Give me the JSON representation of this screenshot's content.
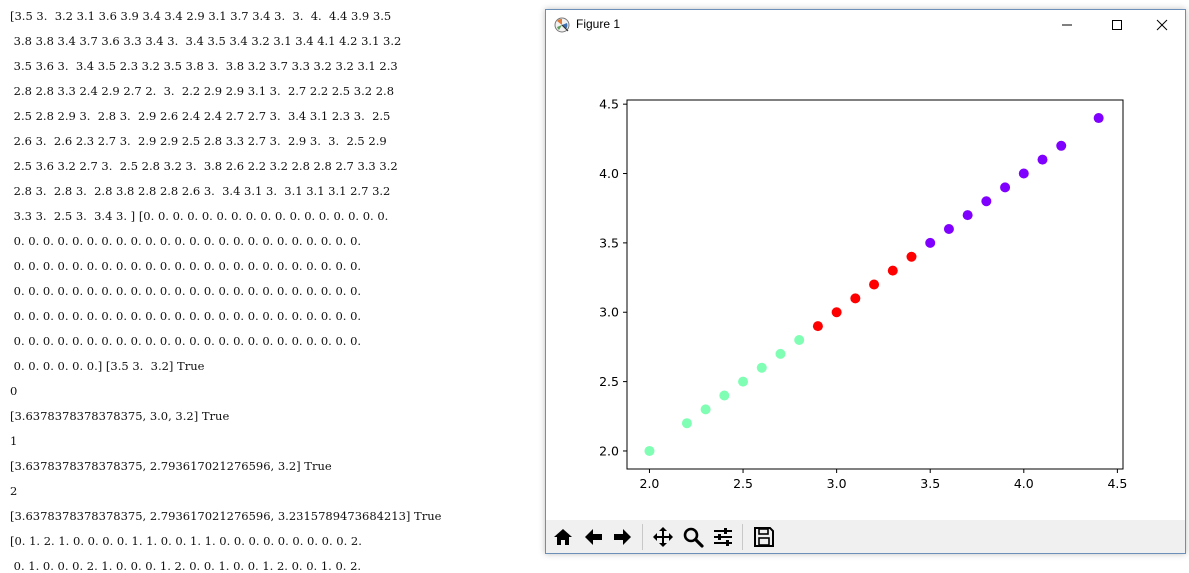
{
  "console": {
    "lines": [
      "[3.5 3.  3.2 3.1 3.6 3.9 3.4 3.4 2.9 3.1 3.7 3.4 3.  3.  4.  4.4 3.9 3.5",
      " 3.8 3.8 3.4 3.7 3.6 3.3 3.4 3.  3.4 3.5 3.4 3.2 3.1 3.4 4.1 4.2 3.1 3.2",
      " 3.5 3.6 3.  3.4 3.5 2.3 3.2 3.5 3.8 3.  3.8 3.2 3.7 3.3 3.2 3.2 3.1 2.3",
      " 2.8 2.8 3.3 2.4 2.9 2.7 2.  3.  2.2 2.9 2.9 3.1 3.  2.7 2.2 2.5 3.2 2.8",
      " 2.5 2.8 2.9 3.  2.8 3.  2.9 2.6 2.4 2.4 2.7 2.7 3.  3.4 3.1 2.3 3.  2.5",
      " 2.6 3.  2.6 2.3 2.7 3.  2.9 2.9 2.5 2.8 3.3 2.7 3.  2.9 3.  3.  2.5 2.9",
      " 2.5 3.6 3.2 2.7 3.  2.5 2.8 3.2 3.  3.8 2.6 2.2 3.2 2.8 2.8 2.7 3.3 3.2",
      " 2.8 3.  2.8 3.  2.8 3.8 2.8 2.8 2.6 3.  3.4 3.1 3.  3.1 3.1 3.1 2.7 3.2",
      " 3.3 3.  2.5 3.  3.4 3. ] [0. 0. 0. 0. 0. 0. 0. 0. 0. 0. 0. 0. 0. 0. 0. 0. 0.",
      " 0. 0. 0. 0. 0. 0. 0. 0. 0. 0. 0. 0. 0. 0. 0. 0. 0. 0. 0. 0. 0. 0. 0. 0.",
      " 0. 0. 0. 0. 0. 0. 0. 0. 0. 0. 0. 0. 0. 0. 0. 0. 0. 0. 0. 0. 0. 0. 0. 0.",
      " 0. 0. 0. 0. 0. 0. 0. 0. 0. 0. 0. 0. 0. 0. 0. 0. 0. 0. 0. 0. 0. 0. 0. 0.",
      " 0. 0. 0. 0. 0. 0. 0. 0. 0. 0. 0. 0. 0. 0. 0. 0. 0. 0. 0. 0. 0. 0. 0. 0.",
      " 0. 0. 0. 0. 0. 0. 0. 0. 0. 0. 0. 0. 0. 0. 0. 0. 0. 0. 0. 0. 0. 0. 0. 0.",
      " 0. 0. 0. 0. 0. 0.] [3.5 3.  3.2] True",
      "0",
      "[3.6378378378378375, 3.0, 3.2] True",
      "1",
      "[3.6378378378378375, 2.793617021276596, 3.2] True",
      "2",
      "[3.6378378378378375, 2.793617021276596, 3.2315789473684213] True",
      "[0. 1. 2. 1. 0. 0. 0. 0. 1. 1. 0. 0. 1. 1. 0. 0. 0. 0. 0. 0. 0. 0. 0. 2.",
      " 0. 1. 0. 0. 0. 2. 1. 0. 0. 0. 1. 2. 0. 0. 1. 0. 0. 1. 2. 0. 0. 1. 0. 2."
    ]
  },
  "window": {
    "title": "Figure 1",
    "controls": {
      "minimize": "minimize-icon",
      "maximize": "maximize-icon",
      "close": "close-icon"
    }
  },
  "toolbar": {
    "buttons": [
      {
        "name": "home-icon"
      },
      {
        "name": "back-arrow-icon"
      },
      {
        "name": "forward-arrow-icon"
      },
      {
        "name": "pan-icon"
      },
      {
        "name": "zoom-icon"
      },
      {
        "name": "configure-subplots-icon"
      },
      {
        "name": "save-icon"
      }
    ]
  },
  "chart_data": {
    "type": "scatter",
    "xlim": [
      1.88,
      4.53
    ],
    "ylim": [
      1.87,
      4.53
    ],
    "xticks": [
      2.0,
      2.5,
      3.0,
      3.5,
      4.0,
      4.5
    ],
    "yticks": [
      2.0,
      2.5,
      3.0,
      3.5,
      4.0,
      4.5
    ],
    "xtick_labels": [
      "2.0",
      "2.5",
      "3.0",
      "3.5",
      "4.0",
      "4.5"
    ],
    "ytick_labels": [
      "2.0",
      "2.5",
      "3.0",
      "3.5",
      "4.0",
      "4.5"
    ],
    "grid": false,
    "series": [
      {
        "color": "#80ffb4",
        "x": [
          2.0,
          2.2,
          2.3,
          2.4,
          2.5,
          2.6,
          2.7,
          2.8
        ],
        "y": [
          2.0,
          2.2,
          2.3,
          2.4,
          2.5,
          2.6,
          2.7,
          2.8
        ]
      },
      {
        "color": "#ff0000",
        "x": [
          2.9,
          3.0,
          3.1,
          3.2,
          3.3,
          3.4
        ],
        "y": [
          2.9,
          3.0,
          3.1,
          3.2,
          3.3,
          3.4
        ]
      },
      {
        "color": "#8000ff",
        "x": [
          3.5,
          3.6,
          3.7,
          3.8,
          3.9,
          4.0,
          4.1,
          4.2,
          4.4
        ],
        "y": [
          3.5,
          3.6,
          3.7,
          3.8,
          3.9,
          4.0,
          4.1,
          4.2,
          4.4
        ]
      }
    ]
  }
}
